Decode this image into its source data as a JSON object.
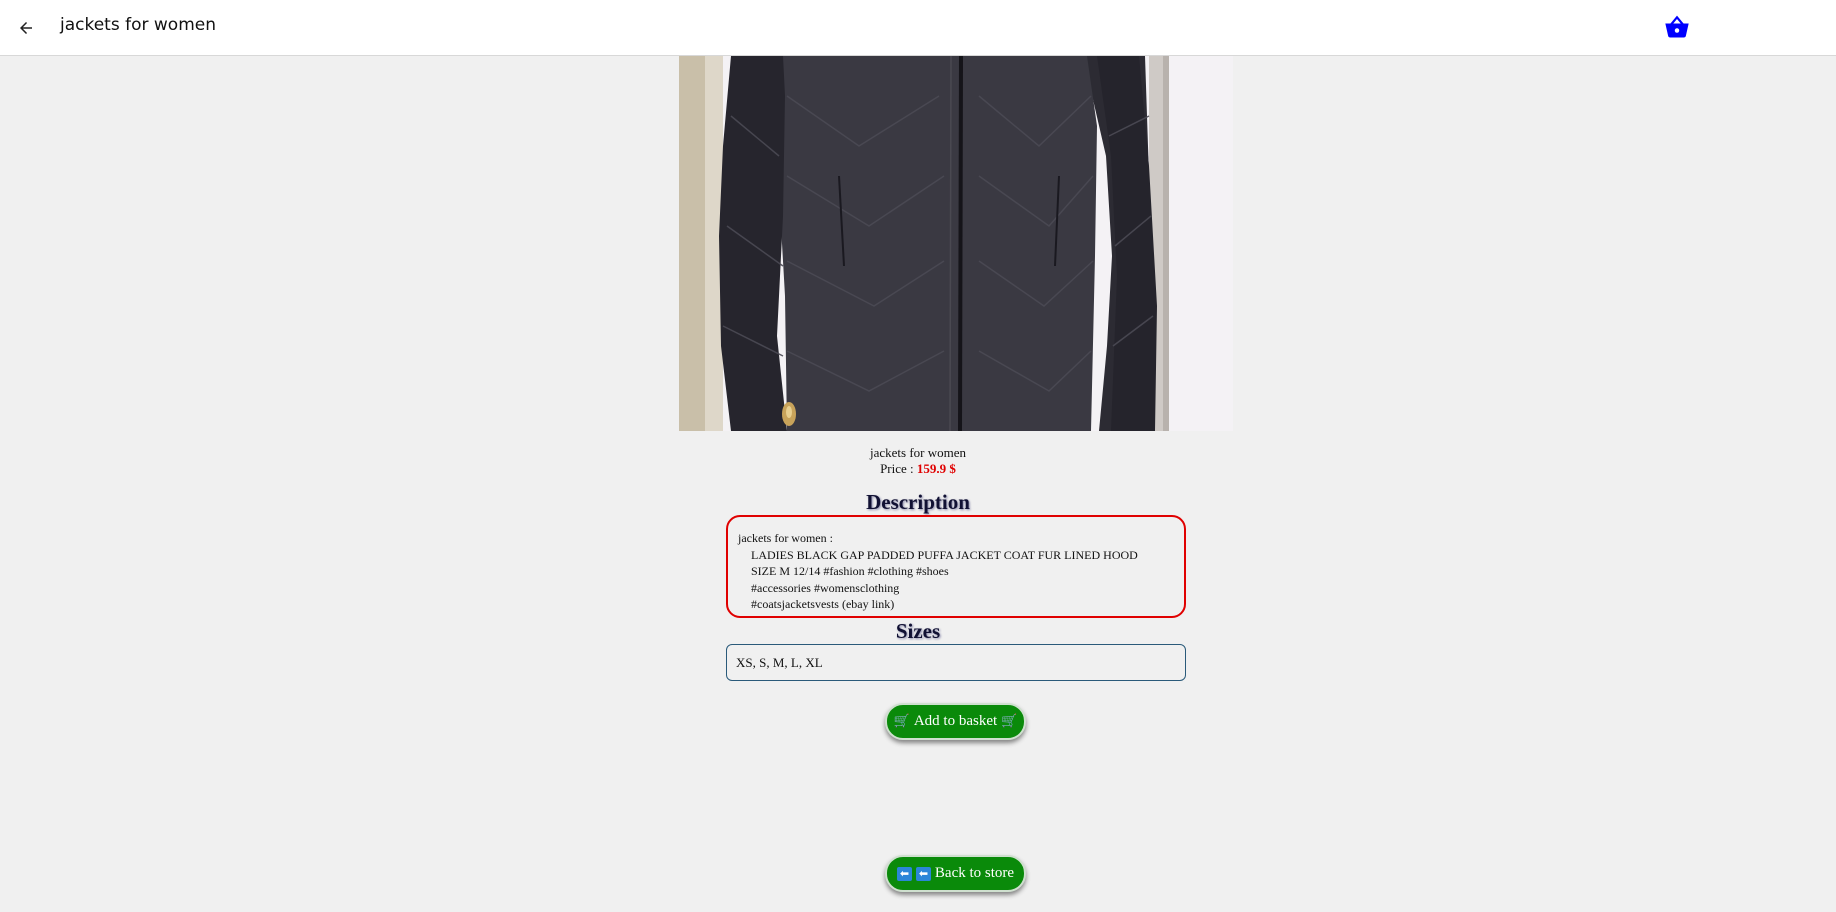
{
  "header": {
    "title": "jackets for women",
    "back_icon": "arrow-left-icon",
    "basket_icon": "basket-icon",
    "basket_color": "#0000ff"
  },
  "product": {
    "image_description": "black padded puffer jacket",
    "name": "jackets for women",
    "price_label": "Price : ",
    "price_value": "159.9 $",
    "price_color": "#e00000"
  },
  "description": {
    "heading": "Description",
    "line1": "jackets for women :",
    "line2": "LADIES BLACK GAP PADDED PUFFA JACKET COAT FUR LINED HOOD",
    "line3": "SIZE M 12/14 #fashion #clothing #shoes",
    "line4": "#accessories #womensclothing",
    "line5": "#coatsjacketsvests (ebay link)"
  },
  "sizes": {
    "heading": "Sizes",
    "value": "XS, S, M, L, XL"
  },
  "buttons": {
    "add_label": "Add to basket",
    "add_icon": "shopping-cart-icon",
    "store_label": "Back to store",
    "store_icon": "left-arrow-icon",
    "button_color": "#0a8a0a"
  }
}
